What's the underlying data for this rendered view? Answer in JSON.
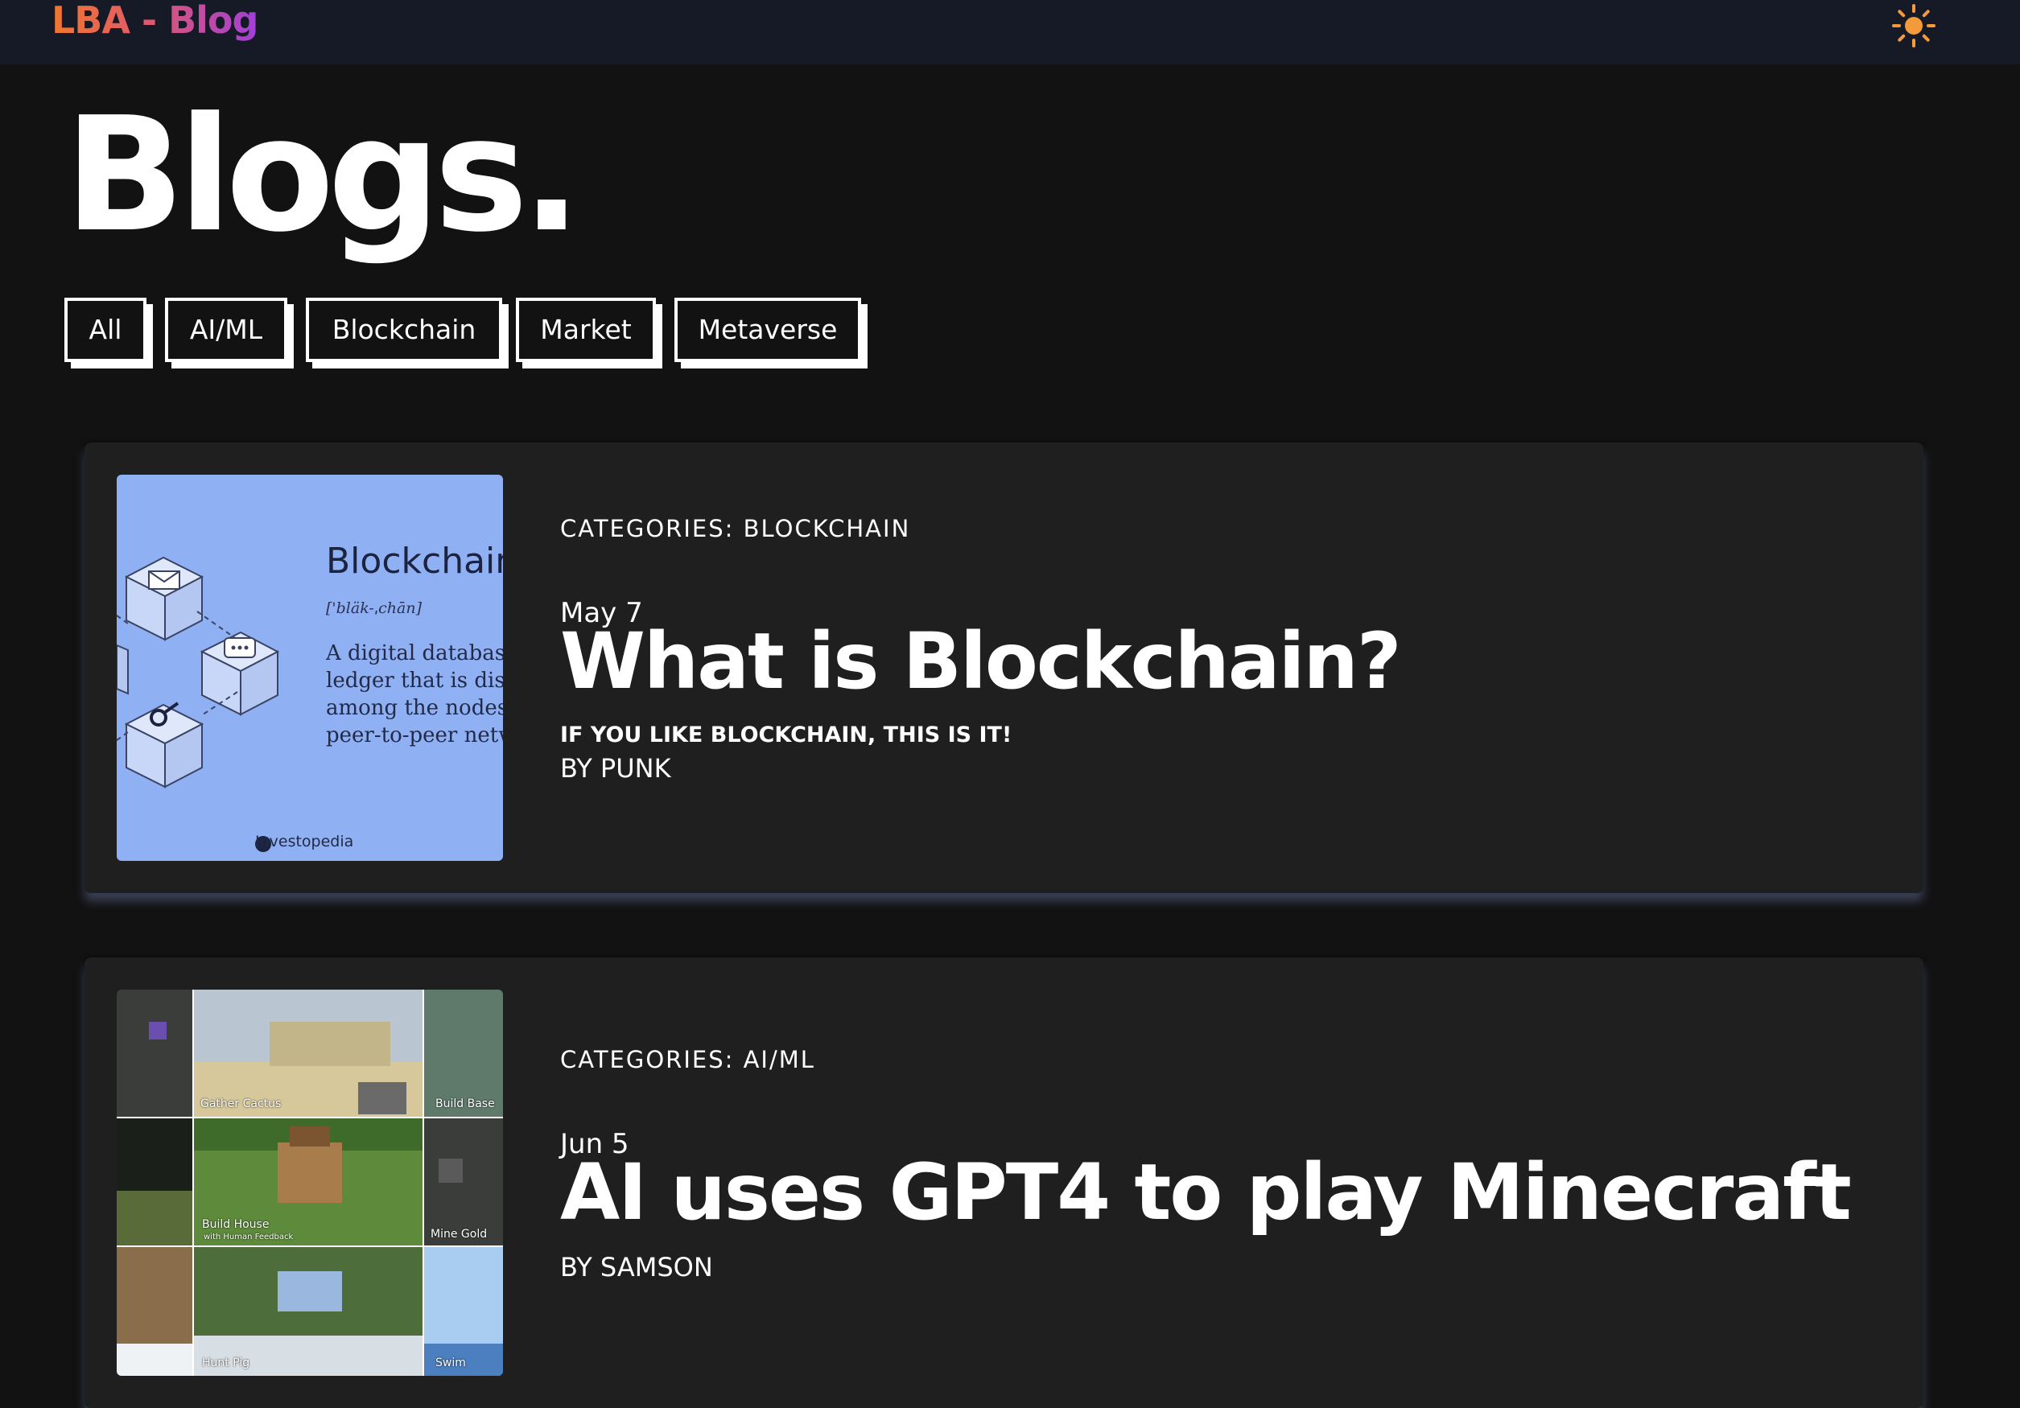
{
  "header": {
    "logo": "LBA - Blog",
    "theme_icon": "sun-icon",
    "logo_colors": [
      "#f0772f",
      "#a23fd6"
    ],
    "sun_color": "#f39a3a"
  },
  "page": {
    "title": "Blogs."
  },
  "filters": [
    "All",
    "AI/ML",
    "Blockchain",
    "Market",
    "Metaverse"
  ],
  "posts": [
    {
      "category": "CATEGORIES: BLOCKCHAIN",
      "date": "May 7",
      "title": "What is Blockchain?",
      "subtitle": "IF YOU LIKE BLOCKCHAIN, THIS IS IT!",
      "author": "BY PUNK",
      "thumbnail": {
        "word": "Blockchain",
        "pronunciation": "['bläk-ˌchān]",
        "definition": "A digital database or\nledger that is distributed\namong the nodes of a\npeer-to-peer network",
        "brand": "Investopedia",
        "background": "#8fb0f2"
      }
    },
    {
      "category": "CATEGORIES: AI/ML",
      "date": "Jun 5",
      "title": "AI uses GPT4 to play Minecraft",
      "subtitle": "",
      "author": "BY SAMSON",
      "thumbnail": {
        "tiles": [
          "Gather Cactus",
          "Build Base",
          "Build House",
          "with Human Feedback",
          "Mine Gold",
          "Hunt Pig",
          "Swim"
        ]
      }
    }
  ]
}
